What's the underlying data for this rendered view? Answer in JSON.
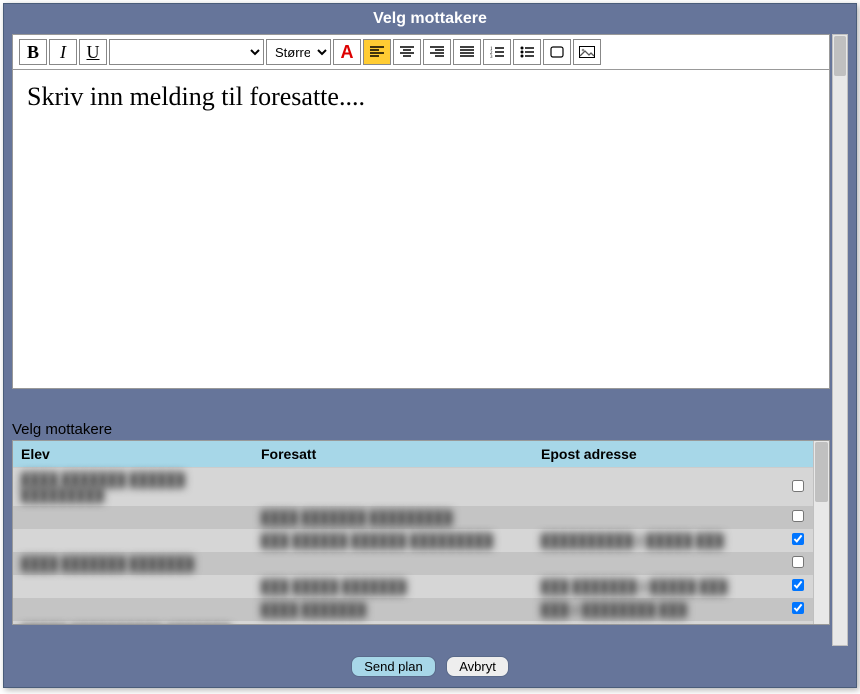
{
  "title": "Velg mottakere",
  "toolbar": {
    "bold": "B",
    "italic": "I",
    "underline": "U",
    "font_select": "",
    "size_select": "Større",
    "fontcolor": "A"
  },
  "editor": {
    "placeholder": "Skriv inn melding til foresatte...."
  },
  "recipients": {
    "label": "Velg mottakere",
    "columns": {
      "elev": "Elev",
      "foresatt": "Foresatt",
      "epost": "Epost adresse"
    },
    "rows": [
      {
        "elev": "████ ███████ ██████ █████████",
        "foresatt": "",
        "epost": "",
        "checked": false,
        "alt": 0
      },
      {
        "elev": "",
        "foresatt": "████ ███████ █████████",
        "epost": "",
        "checked": false,
        "alt": 1
      },
      {
        "elev": "",
        "foresatt": "███ ██████ ██████ █████████",
        "epost": "██████████@█████.███",
        "checked": true,
        "alt": 0
      },
      {
        "elev": "████ ███████ ███████",
        "foresatt": "",
        "epost": "",
        "checked": false,
        "alt": 1
      },
      {
        "elev": "",
        "foresatt": "███ █████ ███████",
        "epost": "███.███████@█████.███",
        "checked": true,
        "alt": 0
      },
      {
        "elev": "",
        "foresatt": "████ ███████",
        "epost": "███@████████.███",
        "checked": true,
        "alt": 1
      },
      {
        "elev": "█████ ██████████ ███████",
        "foresatt": "",
        "epost": "",
        "checked": false,
        "alt": 0
      }
    ]
  },
  "footer": {
    "send": "Send plan",
    "cancel": "Avbryt"
  }
}
